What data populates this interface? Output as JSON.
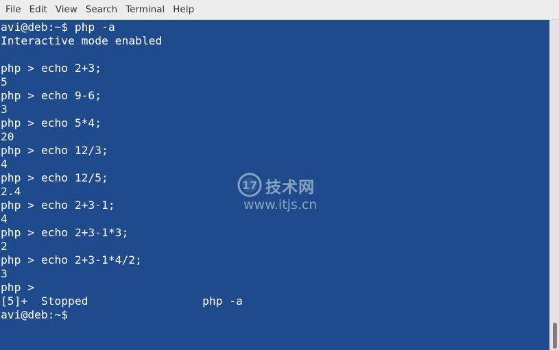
{
  "menu": [
    {
      "label": "File"
    },
    {
      "label": "Edit"
    },
    {
      "label": "View"
    },
    {
      "label": "Search"
    },
    {
      "label": "Terminal"
    },
    {
      "label": "Help"
    }
  ],
  "terminal": {
    "background": "#1f4a8c",
    "foreground": "#ffffff",
    "lines": [
      "avi@deb:~$ php -a",
      "Interactive mode enabled",
      "",
      "php > echo 2+3;",
      "5",
      "php > echo 9-6;",
      "3",
      "php > echo 5*4;",
      "20",
      "php > echo 12/3;",
      "4",
      "php > echo 12/5;",
      "2.4",
      "php > echo 2+3-1;",
      "4",
      "php > echo 2+3-1*3;",
      "2",
      "php > echo 2+3-1*4/2;",
      "3",
      "php >",
      "[5]+  Stopped                 php -a",
      "avi@deb:~$"
    ]
  },
  "watermark": {
    "logo_icon": "17-logo-icon",
    "logo_text": "17",
    "brand": "技术网",
    "url": "www.itjs.cn",
    "color": "#9ab3c9"
  }
}
